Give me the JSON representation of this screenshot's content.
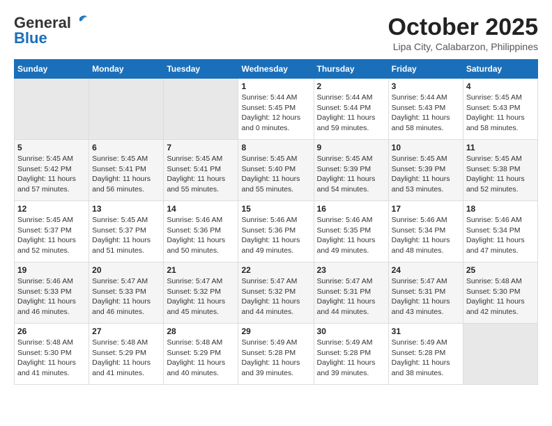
{
  "header": {
    "logo_general": "General",
    "logo_blue": "Blue",
    "title": "October 2025",
    "subtitle": "Lipa City, Calabarzon, Philippines"
  },
  "days_of_week": [
    "Sunday",
    "Monday",
    "Tuesday",
    "Wednesday",
    "Thursday",
    "Friday",
    "Saturday"
  ],
  "weeks": [
    [
      {
        "day": "",
        "info": ""
      },
      {
        "day": "",
        "info": ""
      },
      {
        "day": "",
        "info": ""
      },
      {
        "day": "1",
        "info": "Sunrise: 5:44 AM\nSunset: 5:45 PM\nDaylight: 12 hours\nand 0 minutes."
      },
      {
        "day": "2",
        "info": "Sunrise: 5:44 AM\nSunset: 5:44 PM\nDaylight: 11 hours\nand 59 minutes."
      },
      {
        "day": "3",
        "info": "Sunrise: 5:44 AM\nSunset: 5:43 PM\nDaylight: 11 hours\nand 58 minutes."
      },
      {
        "day": "4",
        "info": "Sunrise: 5:45 AM\nSunset: 5:43 PM\nDaylight: 11 hours\nand 58 minutes."
      }
    ],
    [
      {
        "day": "5",
        "info": "Sunrise: 5:45 AM\nSunset: 5:42 PM\nDaylight: 11 hours\nand 57 minutes."
      },
      {
        "day": "6",
        "info": "Sunrise: 5:45 AM\nSunset: 5:41 PM\nDaylight: 11 hours\nand 56 minutes."
      },
      {
        "day": "7",
        "info": "Sunrise: 5:45 AM\nSunset: 5:41 PM\nDaylight: 11 hours\nand 55 minutes."
      },
      {
        "day": "8",
        "info": "Sunrise: 5:45 AM\nSunset: 5:40 PM\nDaylight: 11 hours\nand 55 minutes."
      },
      {
        "day": "9",
        "info": "Sunrise: 5:45 AM\nSunset: 5:39 PM\nDaylight: 11 hours\nand 54 minutes."
      },
      {
        "day": "10",
        "info": "Sunrise: 5:45 AM\nSunset: 5:39 PM\nDaylight: 11 hours\nand 53 minutes."
      },
      {
        "day": "11",
        "info": "Sunrise: 5:45 AM\nSunset: 5:38 PM\nDaylight: 11 hours\nand 52 minutes."
      }
    ],
    [
      {
        "day": "12",
        "info": "Sunrise: 5:45 AM\nSunset: 5:37 PM\nDaylight: 11 hours\nand 52 minutes."
      },
      {
        "day": "13",
        "info": "Sunrise: 5:45 AM\nSunset: 5:37 PM\nDaylight: 11 hours\nand 51 minutes."
      },
      {
        "day": "14",
        "info": "Sunrise: 5:46 AM\nSunset: 5:36 PM\nDaylight: 11 hours\nand 50 minutes."
      },
      {
        "day": "15",
        "info": "Sunrise: 5:46 AM\nSunset: 5:36 PM\nDaylight: 11 hours\nand 49 minutes."
      },
      {
        "day": "16",
        "info": "Sunrise: 5:46 AM\nSunset: 5:35 PM\nDaylight: 11 hours\nand 49 minutes."
      },
      {
        "day": "17",
        "info": "Sunrise: 5:46 AM\nSunset: 5:34 PM\nDaylight: 11 hours\nand 48 minutes."
      },
      {
        "day": "18",
        "info": "Sunrise: 5:46 AM\nSunset: 5:34 PM\nDaylight: 11 hours\nand 47 minutes."
      }
    ],
    [
      {
        "day": "19",
        "info": "Sunrise: 5:46 AM\nSunset: 5:33 PM\nDaylight: 11 hours\nand 46 minutes."
      },
      {
        "day": "20",
        "info": "Sunrise: 5:47 AM\nSunset: 5:33 PM\nDaylight: 11 hours\nand 46 minutes."
      },
      {
        "day": "21",
        "info": "Sunrise: 5:47 AM\nSunset: 5:32 PM\nDaylight: 11 hours\nand 45 minutes."
      },
      {
        "day": "22",
        "info": "Sunrise: 5:47 AM\nSunset: 5:32 PM\nDaylight: 11 hours\nand 44 minutes."
      },
      {
        "day": "23",
        "info": "Sunrise: 5:47 AM\nSunset: 5:31 PM\nDaylight: 11 hours\nand 44 minutes."
      },
      {
        "day": "24",
        "info": "Sunrise: 5:47 AM\nSunset: 5:31 PM\nDaylight: 11 hours\nand 43 minutes."
      },
      {
        "day": "25",
        "info": "Sunrise: 5:48 AM\nSunset: 5:30 PM\nDaylight: 11 hours\nand 42 minutes."
      }
    ],
    [
      {
        "day": "26",
        "info": "Sunrise: 5:48 AM\nSunset: 5:30 PM\nDaylight: 11 hours\nand 41 minutes."
      },
      {
        "day": "27",
        "info": "Sunrise: 5:48 AM\nSunset: 5:29 PM\nDaylight: 11 hours\nand 41 minutes."
      },
      {
        "day": "28",
        "info": "Sunrise: 5:48 AM\nSunset: 5:29 PM\nDaylight: 11 hours\nand 40 minutes."
      },
      {
        "day": "29",
        "info": "Sunrise: 5:49 AM\nSunset: 5:28 PM\nDaylight: 11 hours\nand 39 minutes."
      },
      {
        "day": "30",
        "info": "Sunrise: 5:49 AM\nSunset: 5:28 PM\nDaylight: 11 hours\nand 39 minutes."
      },
      {
        "day": "31",
        "info": "Sunrise: 5:49 AM\nSunset: 5:28 PM\nDaylight: 11 hours\nand 38 minutes."
      },
      {
        "day": "",
        "info": ""
      }
    ]
  ]
}
